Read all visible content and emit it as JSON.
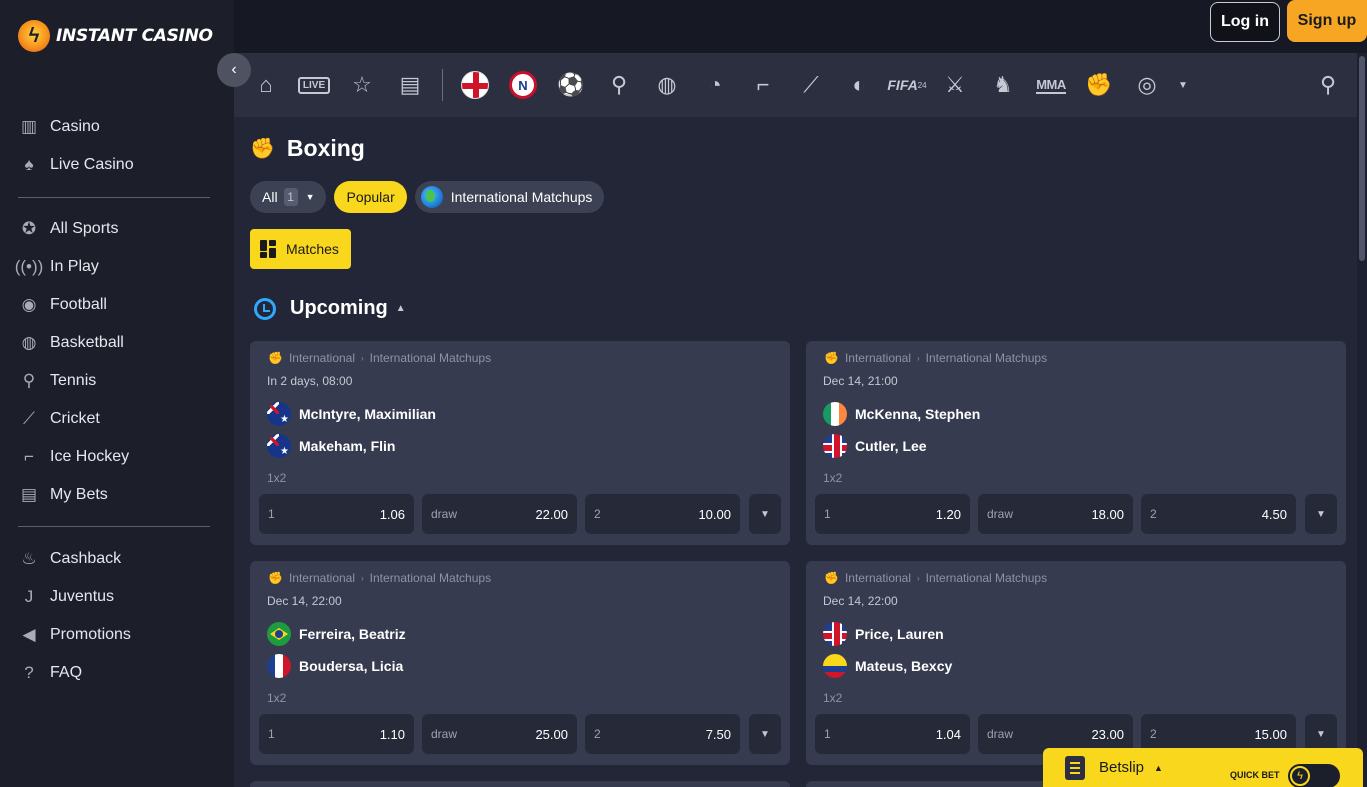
{
  "brand": {
    "name": "INSTANT CASINO"
  },
  "header": {
    "login_label": "Log in",
    "signup_label": "Sign up"
  },
  "sidebar": {
    "group1": [
      {
        "label": "Casino",
        "icon": "slot-machine-icon"
      },
      {
        "label": "Live Casino",
        "icon": "card-icon"
      }
    ],
    "group2": [
      {
        "label": "All Sports",
        "icon": "star-badge-icon"
      },
      {
        "label": "In Play",
        "icon": "broadcast-icon"
      },
      {
        "label": "Football",
        "icon": "football-icon"
      },
      {
        "label": "Basketball",
        "icon": "basketball-icon"
      },
      {
        "label": "Tennis",
        "icon": "tennis-icon"
      },
      {
        "label": "Cricket",
        "icon": "cricket-icon"
      },
      {
        "label": "Ice Hockey",
        "icon": "ice-hockey-icon"
      },
      {
        "label": "My Bets",
        "icon": "my-bets-icon"
      }
    ],
    "group3": [
      {
        "label": "Cashback",
        "icon": "flame-icon"
      },
      {
        "label": "Juventus",
        "icon": "juventus-icon"
      },
      {
        "label": "Promotions",
        "icon": "megaphone-icon"
      },
      {
        "label": "FAQ",
        "icon": "faq-icon"
      }
    ]
  },
  "strip": {
    "live_label": "LIVE",
    "fifa_label": "FIFA",
    "fifa_sub": "24",
    "mma_label": "MMA",
    "nat_label": "N"
  },
  "page": {
    "title": "Boxing"
  },
  "filters": {
    "all_label": "All",
    "all_count": "1",
    "popular_label": "Popular",
    "intl_label": "International Matchups"
  },
  "view": {
    "matches_label": "Matches"
  },
  "section": {
    "title": "Upcoming"
  },
  "matches": [
    {
      "category": "International",
      "tournament": "International Matchups",
      "date": "In 2 days, 08:00",
      "home": "McIntyre, Maximilian",
      "away": "Makeham, Flin",
      "market": "1x2",
      "odds": [
        {
          "label": "1",
          "value": "1.06"
        },
        {
          "label": "draw",
          "value": "22.00"
        },
        {
          "label": "2",
          "value": "10.00"
        }
      ]
    },
    {
      "category": "International",
      "tournament": "International Matchups",
      "date": "Dec 14, 21:00",
      "home": "McKenna, Stephen",
      "away": "Cutler, Lee",
      "market": "1x2",
      "odds": [
        {
          "label": "1",
          "value": "1.20"
        },
        {
          "label": "draw",
          "value": "18.00"
        },
        {
          "label": "2",
          "value": "4.50"
        }
      ]
    },
    {
      "category": "International",
      "tournament": "International Matchups",
      "date": "Dec 14, 22:00",
      "home": "Ferreira, Beatriz",
      "away": "Boudersa, Licia",
      "market": "1x2",
      "odds": [
        {
          "label": "1",
          "value": "1.10"
        },
        {
          "label": "draw",
          "value": "25.00"
        },
        {
          "label": "2",
          "value": "7.50"
        }
      ]
    },
    {
      "category": "International",
      "tournament": "International Matchups",
      "date": "Dec 14, 22:00",
      "home": "Price, Lauren",
      "away": "Mateus, Bexcy",
      "market": "1x2",
      "odds": [
        {
          "label": "1",
          "value": "1.04"
        },
        {
          "label": "draw",
          "value": "23.00"
        },
        {
          "label": "2",
          "value": "15.00"
        }
      ]
    }
  ],
  "betslip": {
    "label": "Betslip",
    "quick_bet_label": "QUICK BET"
  }
}
